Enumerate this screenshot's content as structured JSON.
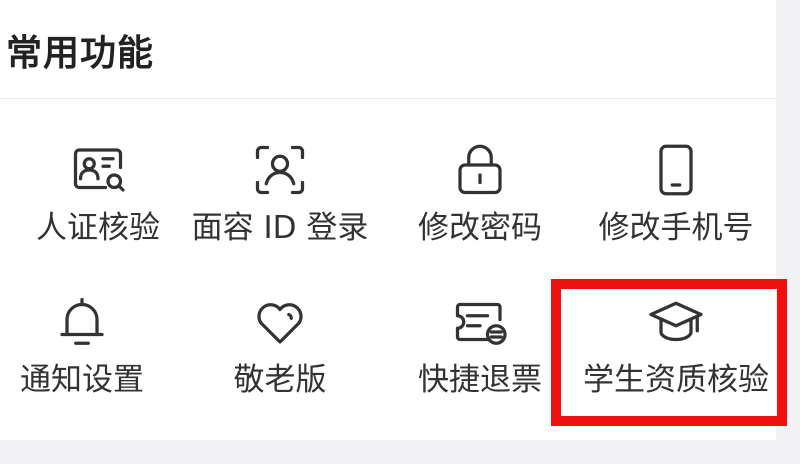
{
  "section": {
    "title": "常用功能"
  },
  "features": [
    {
      "label": "人证核验",
      "icon": "id-card-search-icon"
    },
    {
      "label": "面容 ID 登录",
      "icon": "face-scan-icon"
    },
    {
      "label": "修改密码",
      "icon": "lock-icon"
    },
    {
      "label": "修改手机号",
      "icon": "phone-icon"
    },
    {
      "label": "通知设置",
      "icon": "bell-icon"
    },
    {
      "label": "敬老版",
      "icon": "heart-icon"
    },
    {
      "label": "快捷退票",
      "icon": "ticket-refund-icon"
    },
    {
      "label": "学生资质核验",
      "icon": "graduation-cap-icon"
    }
  ],
  "highlight": {
    "target": "学生资质核验",
    "color": "#ee1111"
  },
  "colors": {
    "icon_stroke": "#333333",
    "text": "#333333",
    "title": "#222222"
  }
}
